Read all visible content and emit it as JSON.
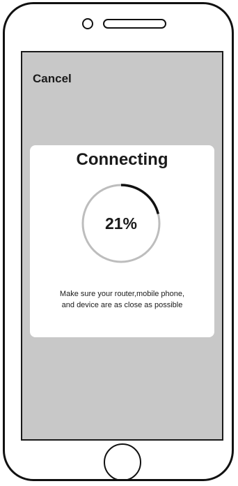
{
  "nav": {
    "cancel_label": "Cancel"
  },
  "dialog": {
    "title": "Connecting",
    "progress_text": "21%",
    "progress_fraction": 0.21,
    "hint_line1": "Make sure your router,mobile phone,",
    "hint_line2": "and device are as close as possible"
  },
  "colors": {
    "screen_background": "#c8c8c8",
    "dialog_background": "#ffffff",
    "ring_track": "#bdbdbd",
    "ring_progress": "#111111",
    "text": "#1a1a1a"
  },
  "icons": {
    "camera": "camera-icon",
    "speaker": "speaker-icon",
    "home": "home-button-icon"
  }
}
